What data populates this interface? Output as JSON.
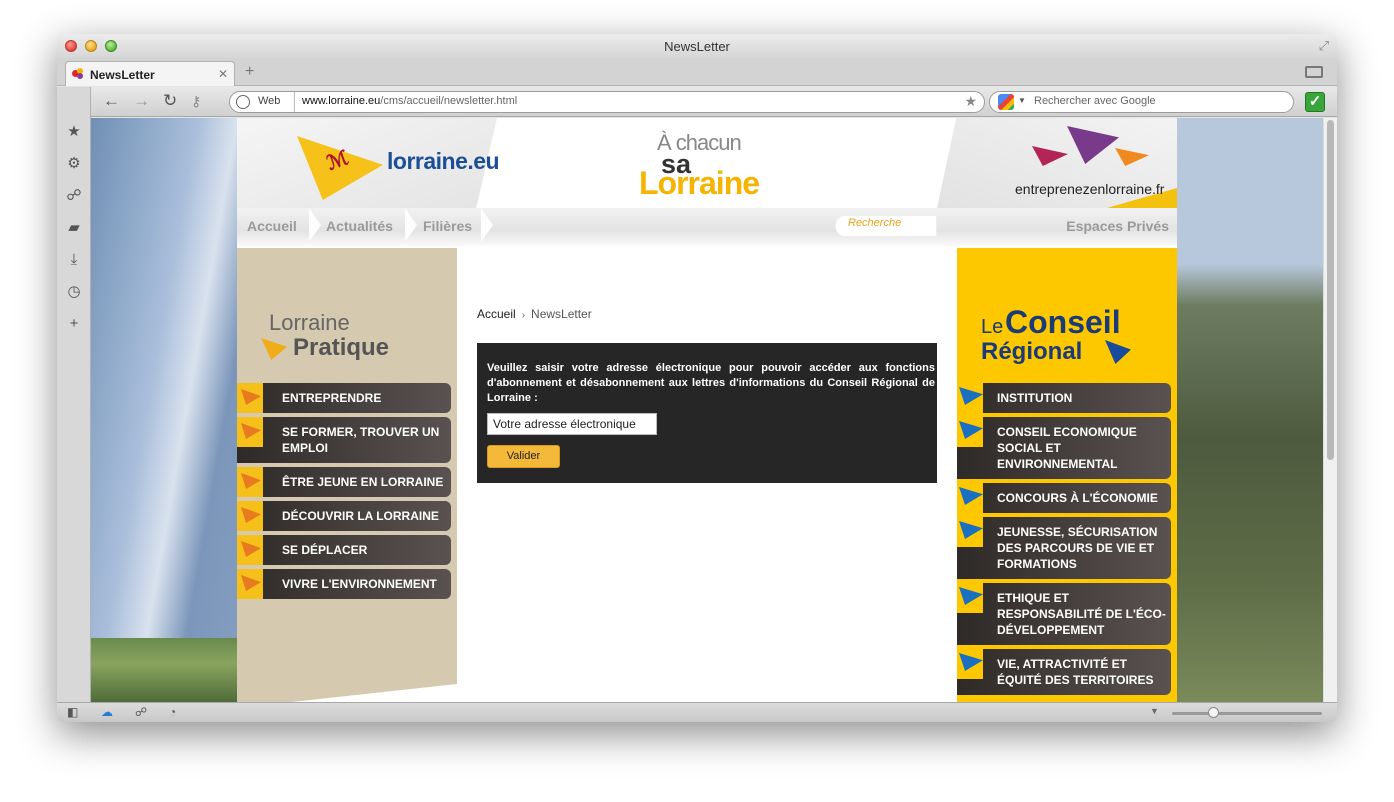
{
  "window": {
    "title": "NewsLetter"
  },
  "tabs": [
    {
      "label": "NewsLetter"
    }
  ],
  "toolbar": {
    "url_scheme_label": "Web",
    "url_domain": "www.lorraine.eu",
    "url_path": "/cms/accueil/newsletter.html",
    "search_placeholder": "Rechercher avec Google"
  },
  "sidepanel": {
    "icons": [
      "bookmarks-star-icon",
      "settings-gear-icon",
      "unite-icon",
      "notes-icon",
      "downloads-icon",
      "history-clock-icon",
      "add-panel-icon"
    ]
  },
  "site": {
    "logo_text": "lorraine.eu",
    "slogan": {
      "line1": "À chacun",
      "line2": "sa",
      "line3": "Lorraine"
    },
    "partner_link": "entreprenezenlorraine.fr",
    "nav": {
      "items": [
        "Accueil",
        "Actualités",
        "Filières"
      ],
      "search_placeholder": "Recherche",
      "espaces": "Espaces Privés"
    },
    "left": {
      "title_line1": "Lorraine",
      "title_line2": "Pratique",
      "menu": [
        "ENTREPRENDRE",
        "SE FORMER, TROUVER UN EMPLOI",
        "ÊTRE JEUNE EN LORRAINE",
        "DÉCOUVRIR LA LORRAINE",
        "SE DÉPLACER",
        "VIVRE L'ENVIRONNEMENT"
      ]
    },
    "right": {
      "title_le": "Le",
      "title_conseil": "Conseil",
      "title_regional": "Régional",
      "menu": [
        "INSTITUTION",
        "CONSEIL ECONOMIQUE SOCIAL ET ENVIRONNEMENTAL",
        "CONCOURS À L'ÉCONOMIE",
        "JEUNESSE, SÉCURISATION DES PARCOURS DE VIE ET FORMATIONS",
        "ETHIQUE ET RESPONSABILITÉ DE L'ÉCO-DÉVELOPPEMENT",
        "VIE, ATTRACTIVITÉ ET ÉQUITÉ DES TERRITOIRES"
      ]
    },
    "breadcrumb": {
      "home": "Accueil",
      "separator": "›",
      "current": "NewsLetter"
    },
    "newsletter": {
      "instructions": "Veuillez saisir votre adresse électronique pour pouvoir accéder aux fonctions d'abonnement et désabonnement aux lettres d'informations du Conseil Régional de Lorraine :",
      "email_value": "Votre adresse électronique",
      "submit_label": "Valider"
    }
  }
}
